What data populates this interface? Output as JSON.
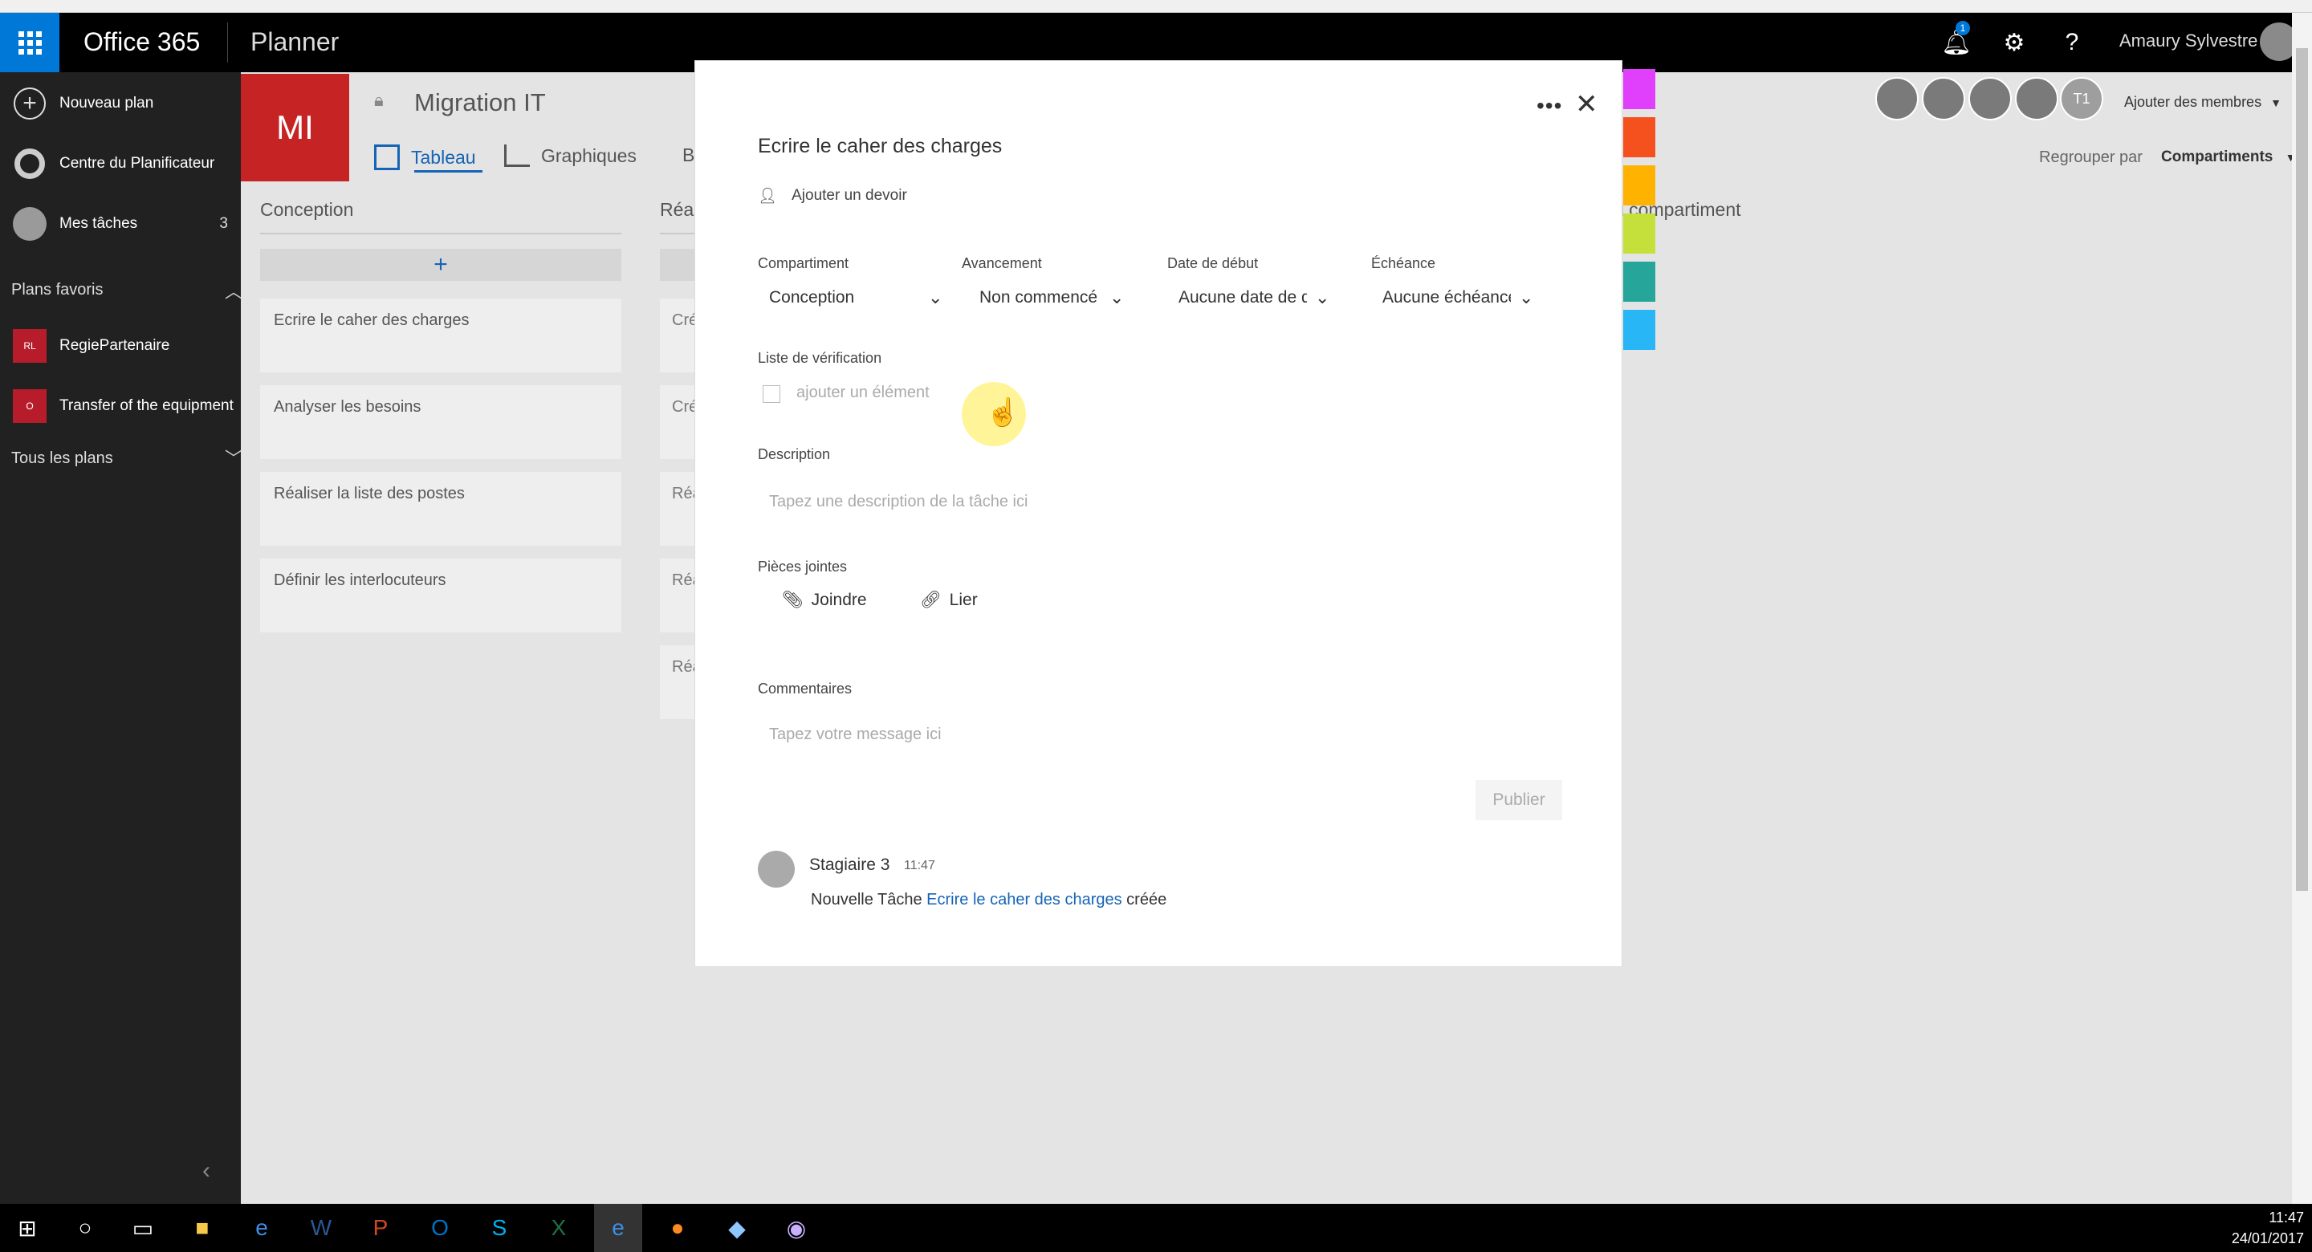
{
  "topbar": {
    "suite": "Office 365",
    "app": "Planner",
    "notification_count": "1",
    "user_name": "Amaury Sylvestre",
    "help": "?"
  },
  "sidebar": {
    "new_plan": "Nouveau plan",
    "hub": "Centre du Planificateur",
    "my_tasks": "Mes tâches",
    "my_tasks_count": "3",
    "favorites_label": "Plans favoris",
    "favorites": [
      {
        "badge": "RL",
        "name": "RegiePartenaire"
      },
      {
        "badge": "O",
        "name": "Transfer of the equipment"
      }
    ],
    "all_plans": "Tous les plans"
  },
  "plan": {
    "initials": "MI",
    "name": "Migration IT",
    "tabs": [
      "Tableau",
      "Graphiques",
      "B"
    ],
    "add_members": "Ajouter des membres",
    "group_by_label": "Regrouper par",
    "group_by_value": "Compartiments",
    "member_t1": "T1",
    "new_bucket": "u compartiment",
    "bucket_colors": [
      "#e040fb",
      "#f4511e",
      "#ffb300",
      "#c6e03b",
      "#26a69a",
      "#29b6f6"
    ]
  },
  "buckets": [
    {
      "name": "Conception",
      "add": "+",
      "cards": [
        "Ecrire le caher des charges",
        "Analyser les besoins",
        "Réaliser la liste des postes",
        "Définir les interlocuteurs"
      ]
    },
    {
      "name": "Réal",
      "cards": [
        "Cré",
        "Cré",
        "Réa",
        "Réa",
        "Réa"
      ]
    }
  ],
  "task": {
    "title": "Ecrire le caher des charges",
    "assign": "Ajouter un devoir",
    "fields": {
      "bucket_label": "Compartiment",
      "bucket_value": "Conception",
      "progress_label": "Avancement",
      "progress_value": "Non commencé",
      "start_label": "Date de début",
      "start_value": "Aucune date de début",
      "due_label": "Échéance",
      "due_value": "Aucune échéance"
    },
    "checklist_label": "Liste de vérification",
    "checklist_placeholder": "ajouter un élément",
    "description_label": "Description",
    "description_placeholder": "Tapez une description de la tâche ici",
    "attachments_label": "Pièces jointes",
    "attach": "Joindre",
    "link": "Lier",
    "comments_label": "Commentaires",
    "comment_placeholder": "Tapez votre message ici",
    "publish": "Publier",
    "activity": {
      "author": "Stagiaire 3",
      "time": "11:47",
      "prefix": "Nouvelle Tâche ",
      "task_link": "Ecrire le caher des charges",
      "suffix": " créée"
    }
  },
  "taskbar": {
    "time": "11:47",
    "date": "24/01/2017"
  }
}
